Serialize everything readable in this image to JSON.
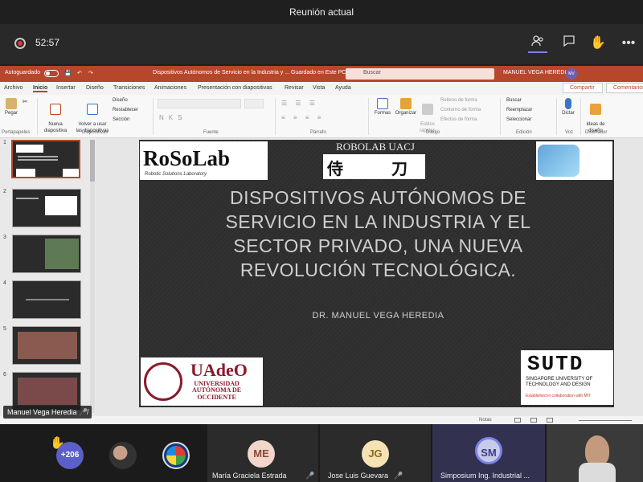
{
  "meeting": {
    "title": "Reunión actual",
    "timer": "52:57"
  },
  "ppt": {
    "autosave_label": "Autoguardado",
    "doc_title": "Dispositivos Autónomos de Servicio en la Industria y ... Guardado en Este PC",
    "search_placeholder": "Buscar",
    "user_name": "MANUEL VEGA HEREDIA",
    "user_initials": "MV",
    "tabs": [
      "Archivo",
      "Inicio",
      "Insertar",
      "Diseño",
      "Transiciones",
      "Animaciones",
      "Presentación con diapositivas",
      "Revisar",
      "Vista",
      "Ayuda"
    ],
    "share_label": "Compartir",
    "comments_label": "Comentarios",
    "ribbon": {
      "paste": "Pegar",
      "new_slide": "Nueva\ndiapositiva",
      "reuse": "Volver a usar\nlas diapositivas",
      "design": "Diseño",
      "reset": "Restablecer",
      "section": "Sección",
      "shapes": "Formas",
      "arrange": "Organizar",
      "quick_styles": "Estilos\nrápidos",
      "fill": "Relleno de forma",
      "outline": "Contorno de forma",
      "effects": "Efectos de forma",
      "find": "Buscar",
      "replace": "Reemplazar",
      "select": "Seleccionar",
      "dictate": "Dictar",
      "designer": "Ideas de\ndiseño",
      "groups": [
        "Portapapeles",
        "Diapositivas",
        "Fuente",
        "Párrafo",
        "Dibujo",
        "Edición",
        "Voz",
        "Diseñador"
      ]
    },
    "thumbnails": [
      "1",
      "2",
      "3",
      "4",
      "5",
      "6"
    ],
    "slide": {
      "title": "DISPOSITIVOS AUTÓNOMOS DE SERVICIO EN LA INDUSTRIA Y EL SECTOR PRIVADO, UNA NUEVA REVOLUCIÓN TECNOLÓGICA.",
      "author": "DR. MANUEL VEGA HEREDIA",
      "robolab_title": "ROBOLAB UACJ",
      "rosolab": "RoSoLab",
      "rosolab_sub": "Robotic Solutions Laboratory",
      "uadeo_big": "UAdeO",
      "uadeo_small": "UNIVERSIDAD\nAUTÓNOMA DE\nOCCIDENTE",
      "sutd_big": "SUTD",
      "sutd_small": "SINGAPORE UNIVERSITY OF\nTECHNOLOGY AND DESIGN",
      "sutd_mit": "Established in collaboration with MIT"
    },
    "status": {
      "notes": "Notas"
    }
  },
  "presenter_tag": "Manuel Vega Heredia",
  "participants": {
    "overflow_count": "+206",
    "people": [
      {
        "initials": "ME",
        "name": "María Graciela Estrada"
      },
      {
        "initials": "JG",
        "name": "Jose Luis Guevara"
      },
      {
        "initials": "SM",
        "name": "Simposium Ing. Industrial ..."
      }
    ]
  },
  "colors": {
    "ppt_brand": "#b7472a",
    "teams_accent": "#7b83eb"
  }
}
